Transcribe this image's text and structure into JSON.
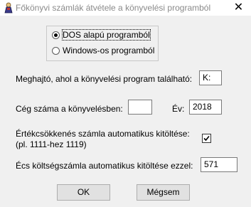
{
  "window": {
    "title": "Főkönyvi számlák átvétele a könyvelési programból",
    "close_glyph": "✕"
  },
  "source": {
    "options": [
      "DOS alapú programból",
      "Windows-os programból"
    ],
    "selected": "DOS alapú programból"
  },
  "drive": {
    "label": "Meghajtó, ahol a könyvelési program található:",
    "value": "K:"
  },
  "company": {
    "label": "Cég száma a könyvelésben:",
    "value": ""
  },
  "year": {
    "label": "Év:",
    "value": "2018"
  },
  "depreciation": {
    "label_line1": "Értékcsökkenés számla automatikus kitöltése:",
    "label_line2": "(pl. 1111-hez 1119)",
    "checked": true
  },
  "expense": {
    "label": "Écs költségszámla automatikus kitöltése ezzel:",
    "value": "571"
  },
  "buttons": {
    "ok": "OK",
    "cancel": "Mégsem"
  }
}
